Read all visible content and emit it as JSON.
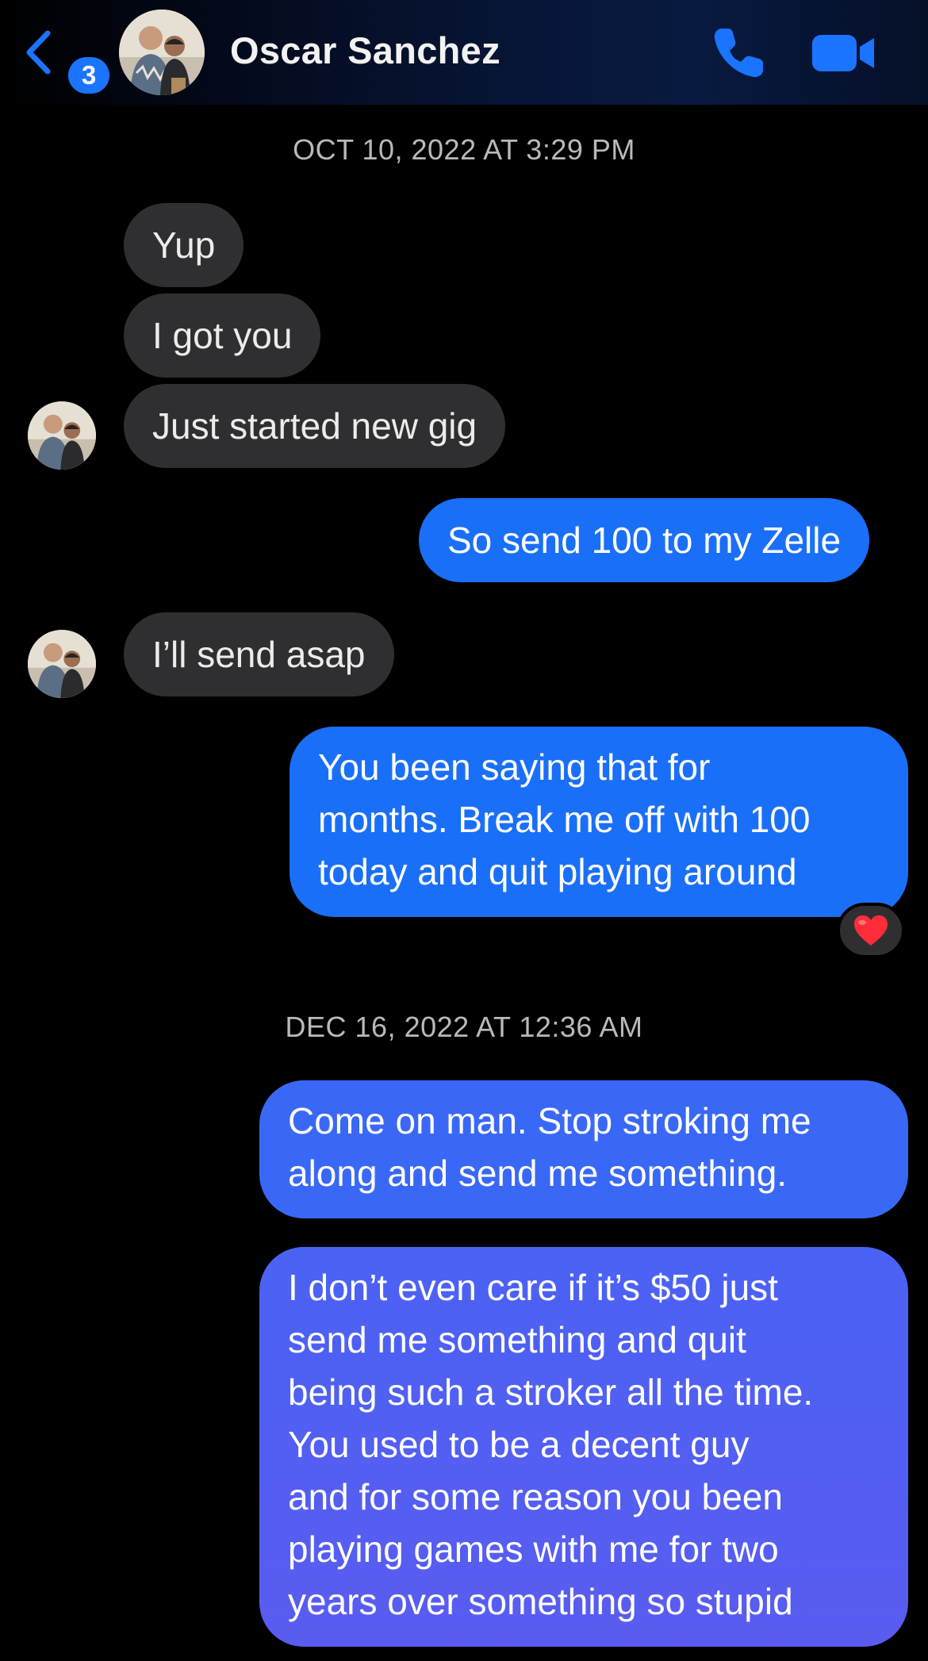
{
  "header": {
    "unread_count": "3",
    "contact_name": "Oscar Sanchez",
    "icons": {
      "back": "chevron-left-icon",
      "phone": "phone-icon",
      "video": "video-camera-icon"
    },
    "accent_color": "#1a74ff"
  },
  "conversation": {
    "timestamps": [
      "OCT 10, 2022 AT 3:29 PM",
      "DEC 16, 2022 AT 12:36 AM"
    ],
    "messages": [
      {
        "sender": "them",
        "text": "Yup"
      },
      {
        "sender": "them",
        "text": "I got you"
      },
      {
        "sender": "them",
        "text": "Just started new gig"
      },
      {
        "sender": "me",
        "text": "So send 100 to my Zelle"
      },
      {
        "sender": "them",
        "text": "I’ll send asap"
      },
      {
        "sender": "me",
        "lines": [
          "You been saying that for",
          "months. Break me off with 100",
          "today and quit playing around"
        ],
        "reaction": "❤️"
      },
      {
        "sender": "me",
        "lines": [
          "Come on man. Stop stroking me",
          "along and send me something."
        ]
      },
      {
        "sender": "me",
        "lines": [
          "I don’t even care if it’s $50 just",
          "send me something and quit",
          "being such a stroker all the time.",
          "You used to be a decent guy",
          "and for some reason you been",
          "playing games with me for two",
          "years over something so stupid"
        ]
      }
    ]
  },
  "colors": {
    "incoming_bubble": "#2f2f31",
    "outgoing_gradient_top": "#1a6ff8",
    "outgoing_gradient_bottom": "#5a5cf0",
    "reaction_heart": "#ff2d3a"
  }
}
